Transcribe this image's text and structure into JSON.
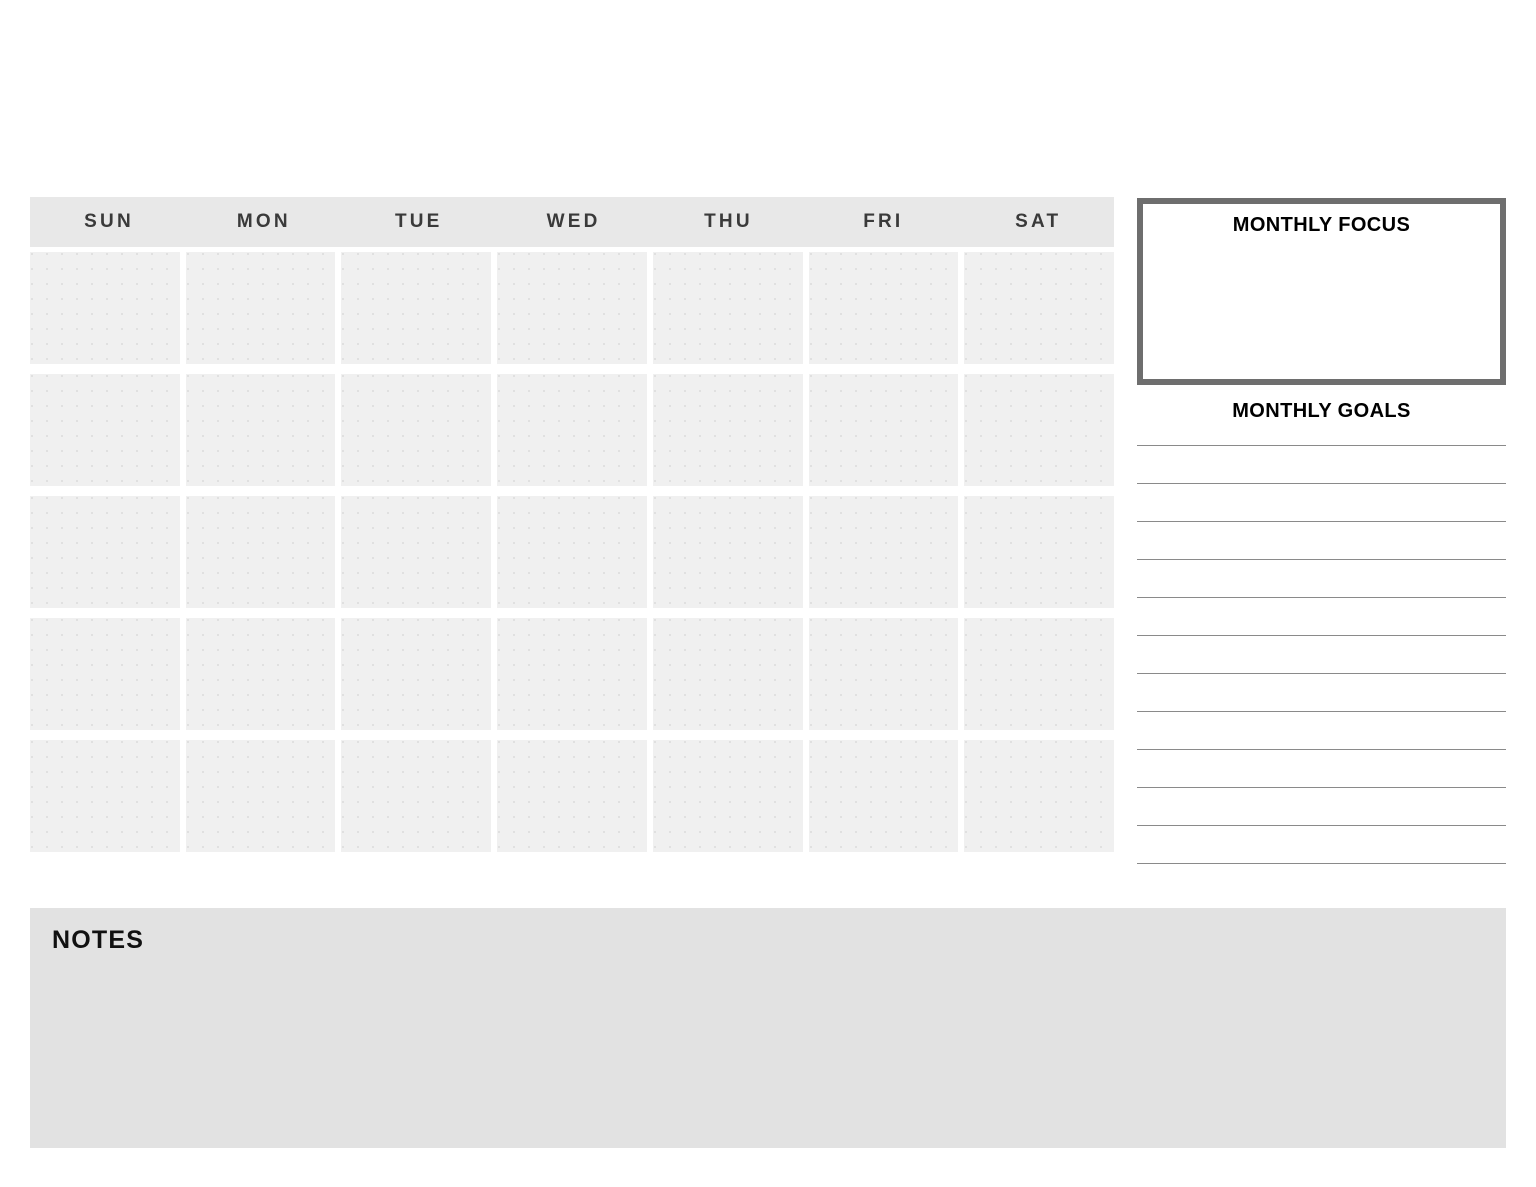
{
  "calendar": {
    "weekdays": [
      "SUN",
      "MON",
      "TUE",
      "WED",
      "THU",
      "FRI",
      "SAT"
    ],
    "rows": 5,
    "columns": 7,
    "cells": [
      "",
      "",
      "",
      "",
      "",
      "",
      "",
      "",
      "",
      "",
      "",
      "",
      "",
      "",
      "",
      "",
      "",
      "",
      "",
      "",
      "",
      "",
      "",
      "",
      "",
      "",
      "",
      "",
      "",
      "",
      "",
      "",
      "",
      "",
      ""
    ],
    "header_background": "#e8e8e8",
    "cell_background": "#f0f0f0",
    "weekday_text_color": "#3a3a3a"
  },
  "monthly_focus": {
    "title": "MONTHLY FOCUS",
    "content": "",
    "border_color": "#6e6e6e",
    "background": "#ffffff"
  },
  "monthly_goals": {
    "title": "MONTHLY GOALS",
    "line_count": 12,
    "lines": [
      "",
      "",
      "",
      "",
      "",
      "",
      "",
      "",
      "",
      "",
      "",
      ""
    ],
    "line_color": "#8a8a8a"
  },
  "notes": {
    "title": "NOTES",
    "content": "",
    "background": "#e2e2e2"
  }
}
